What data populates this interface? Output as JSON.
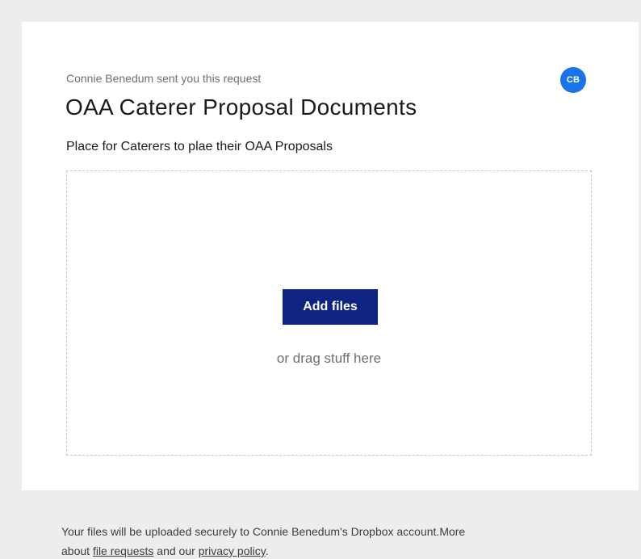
{
  "request": {
    "sender_text": "Connie Benedum sent you this request",
    "avatar_initials": "CB",
    "title": "OAA Caterer Proposal Documents",
    "description": "Place for Caterers to plae their OAA Proposals"
  },
  "dropzone": {
    "add_files_label": "Add files",
    "drag_hint": "or drag stuff here"
  },
  "footer": {
    "line1": "Your files will be uploaded securely to Connie Benedum's Dropbox account.More",
    "about_text": "about ",
    "file_requests_link": "file requests",
    "and_text": " and our ",
    "privacy_link": "privacy policy",
    "end_text": "."
  },
  "colors": {
    "accent": "#0d2481",
    "avatar": "#1a73e8",
    "background": "#ededed"
  }
}
